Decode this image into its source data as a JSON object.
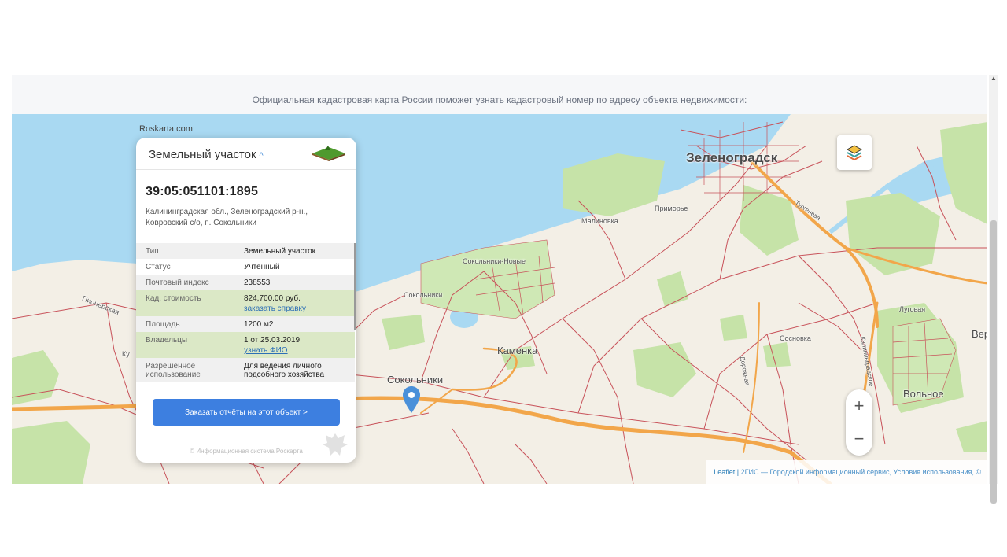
{
  "intro": {
    "text": "Официальная кадастровая карта России поможет узнать кадастровый номер по адресу объекта недвижимости:"
  },
  "map": {
    "site_label": "Roskarta.com",
    "places": {
      "zelenogradsk": "Зеленоградск",
      "kamenka": "Каменка",
      "sokolniki": "Сокольники",
      "volnoe": "Вольное",
      "ver": "Вер",
      "sokolniki_novye": "Сокольники-Новые",
      "sokolniki_small": "Сокольники",
      "malinovka": "Малиновка",
      "primorye": "Приморье",
      "sosnovka": "Сосновка",
      "lugovaya": "Луговая",
      "pionerskaya": "Пионерская",
      "ku": "Ку",
      "turgeneva": "Тургенева",
      "kaliningradskoe": "Калининградское",
      "dorozhnaya": "Дорожная"
    },
    "zoom": {
      "in": "+",
      "out": "−"
    },
    "attribution": {
      "leaflet": "Leaflet",
      "sep": "|",
      "text": "2ГИС — Городской информационный сервис, Условия использования, ©"
    },
    "colors": {
      "water": "#a9d9f2",
      "land": "#f3efe6",
      "forest": "#c6e3a8",
      "road": "#f2a64a",
      "boundary": "#c8525a",
      "accent": "#3d7fe0"
    }
  },
  "panel": {
    "title": "Земельный участок",
    "cadastral_number": "39:05:051101:1895",
    "address": "Калининградская обл., Зеленоградский р-н., Ковровский с/о, п. Сокольники",
    "rows": [
      {
        "key": "Тип",
        "value": "Земельный участок",
        "link": ""
      },
      {
        "key": "Статус",
        "value": "Учтенный",
        "link": ""
      },
      {
        "key": "Почтовый индекс",
        "value": "238553",
        "link": ""
      },
      {
        "key": "Кад. стоимость",
        "value": "824,700.00 руб.",
        "link": "заказать справку"
      },
      {
        "key": "Площадь",
        "value": "1200 м2",
        "link": ""
      },
      {
        "key": "Владельцы",
        "value": "1 от 25.03.2019",
        "link": "узнать ФИО"
      },
      {
        "key": "Разрешенное использование",
        "value": "Для ведения личного подсобного хозяйства",
        "link": ""
      }
    ],
    "order_button": "Заказать отчёты на этот объект >",
    "copyright": "© Информационная система Роскарта"
  }
}
